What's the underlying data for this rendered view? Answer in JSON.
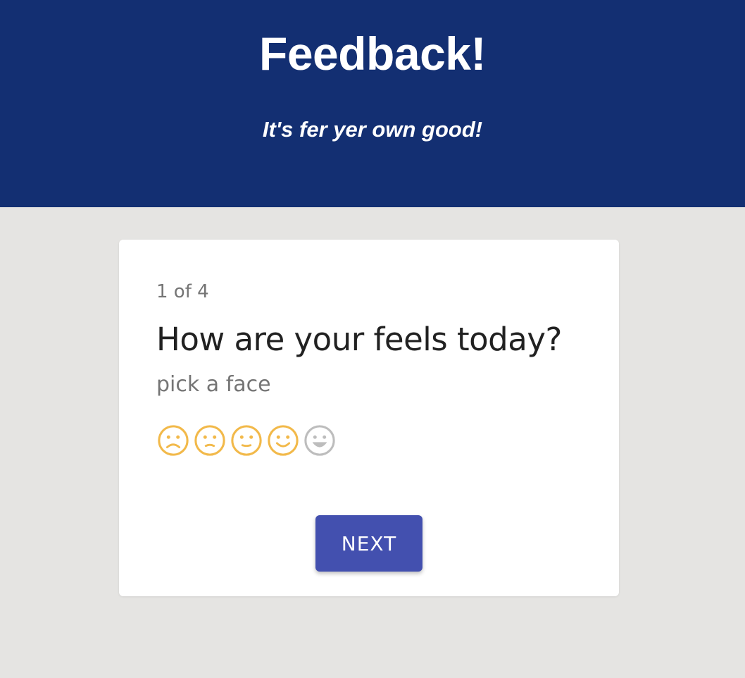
{
  "header": {
    "title": "Feedback!",
    "subtitle": "It's fer yer own good!"
  },
  "survey": {
    "step": "1 of 4",
    "question": "How are your feels today?",
    "hint": "pick a face",
    "faces": [
      {
        "name": "very-sad-face-icon",
        "mood": "very-sad",
        "state": "filled"
      },
      {
        "name": "sad-face-icon",
        "mood": "sad",
        "state": "filled"
      },
      {
        "name": "neutral-face-icon",
        "mood": "neutral",
        "state": "filled"
      },
      {
        "name": "happy-face-icon",
        "mood": "happy",
        "state": "filled"
      },
      {
        "name": "very-happy-face-icon",
        "mood": "very-happy",
        "state": "unselected"
      }
    ],
    "rating": 4,
    "rating_max": 5,
    "next_label": "NEXT"
  },
  "colors": {
    "header_bg": "#132f72",
    "page_bg": "#e5e4e2",
    "face_active": "#f2b94a",
    "face_inactive": "#bdbdbd",
    "button_bg": "#4350af"
  }
}
